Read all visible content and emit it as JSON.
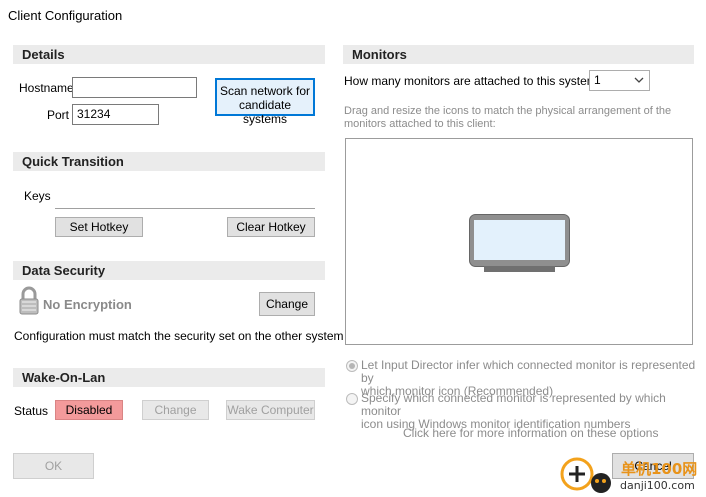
{
  "window": {
    "title": "Client Configuration"
  },
  "details": {
    "header": "Details",
    "hostname_label": "Hostname",
    "hostname_value": "",
    "port_label": "Port",
    "port_value": "31234",
    "scan_button_line1": "Scan network for",
    "scan_button_line2": "candidate systems"
  },
  "quick_transition": {
    "header": "Quick Transition",
    "keys_label": "Keys",
    "set_hotkey": "Set Hotkey",
    "clear_hotkey": "Clear Hotkey"
  },
  "data_security": {
    "header": "Data Security",
    "status": "No Encryption",
    "change": "Change",
    "note": "Configuration must match the security set on the other system"
  },
  "wake_on_lan": {
    "header": "Wake-On-Lan",
    "status_label": "Status",
    "status_value": "Disabled",
    "change": "Change",
    "wake": "Wake Computer"
  },
  "monitors": {
    "header": "Monitors",
    "count_question": "How many monitors are attached to this system",
    "count_value": "1",
    "instructions_line1": "Drag and resize the icons to match the physical arrangement of the",
    "instructions_line2": "monitors attached to this client:",
    "radio1_line1": "Let Input Director infer which connected monitor is represented by",
    "radio1_line2": "which monitor icon (Recommended)",
    "radio2_line1": "Specify which connected monitor is represented by which monitor",
    "radio2_line2": "icon using Windows monitor identification numbers",
    "more_info": "Click here for more information on these options"
  },
  "footer": {
    "ok": "OK",
    "cancel": "Cancel"
  },
  "watermark": {
    "line1": "单机100网",
    "line2": "danji100.com"
  },
  "icons": [
    "lock-icon",
    "monitor-icon",
    "chevron-down-icon",
    "watermark-logo-icon"
  ],
  "colors": {
    "section_bg": "#ebebeb",
    "disabled_badge": "#f39a9b",
    "focus_border": "#0078d7"
  }
}
